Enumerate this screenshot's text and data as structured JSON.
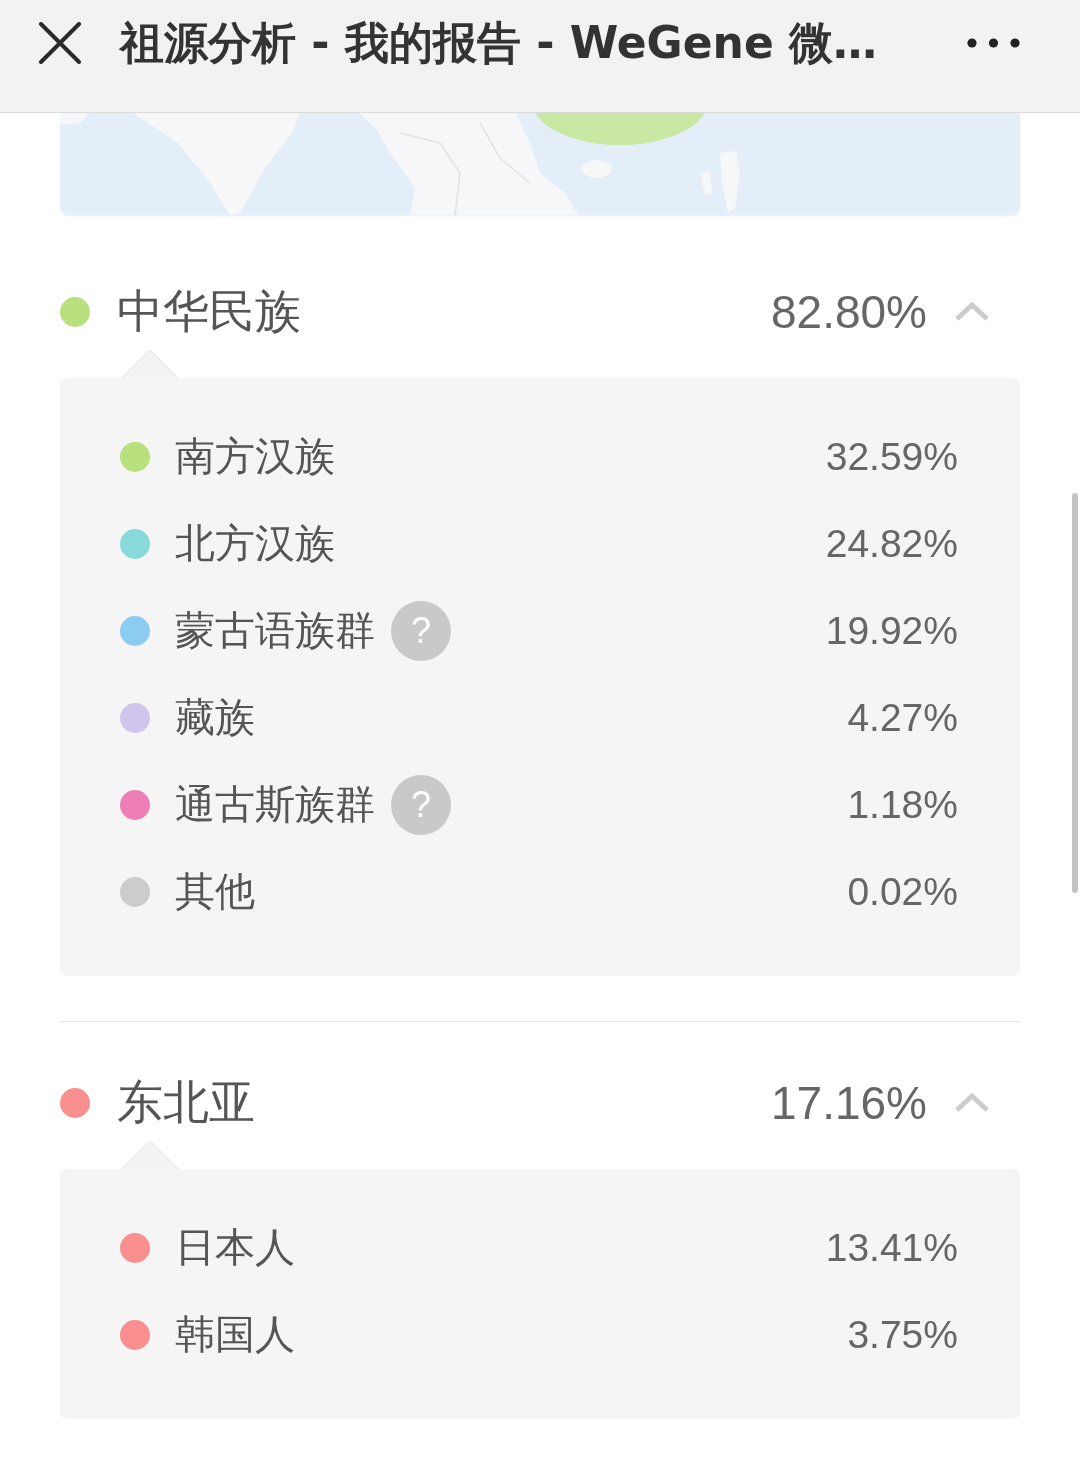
{
  "top_bar": {
    "title": "祖源分析 - 我的报告 - WeGene 微…"
  },
  "ancestry_groups": [
    {
      "name": "中华民族",
      "percentage": "82.80%",
      "color": "#b8e07e",
      "expanded": true,
      "subgroups": [
        {
          "name": "南方汉族",
          "percentage": "32.59%",
          "color": "#b8e07e"
        },
        {
          "name": "北方汉族",
          "percentage": "24.82%",
          "color": "#88dada"
        },
        {
          "name": "蒙古语族群",
          "percentage": "19.92%",
          "color": "#8ccbf2",
          "help": "?"
        },
        {
          "name": "藏族",
          "percentage": "4.27%",
          "color": "#d0c6ec"
        },
        {
          "name": "通古斯族群",
          "percentage": "1.18%",
          "color": "#ee7eb6",
          "help": "?"
        },
        {
          "name": "其他",
          "percentage": "0.02%",
          "color": "#cccccc"
        }
      ]
    },
    {
      "name": "东北亚",
      "percentage": "17.16%",
      "color": "#fa8f8f",
      "expanded": true,
      "subgroups": [
        {
          "name": "日本人",
          "percentage": "13.41%",
          "color": "#fa8f8f"
        },
        {
          "name": "韩国人",
          "percentage": "3.75%",
          "color": "#fa8f8f"
        }
      ]
    }
  ]
}
